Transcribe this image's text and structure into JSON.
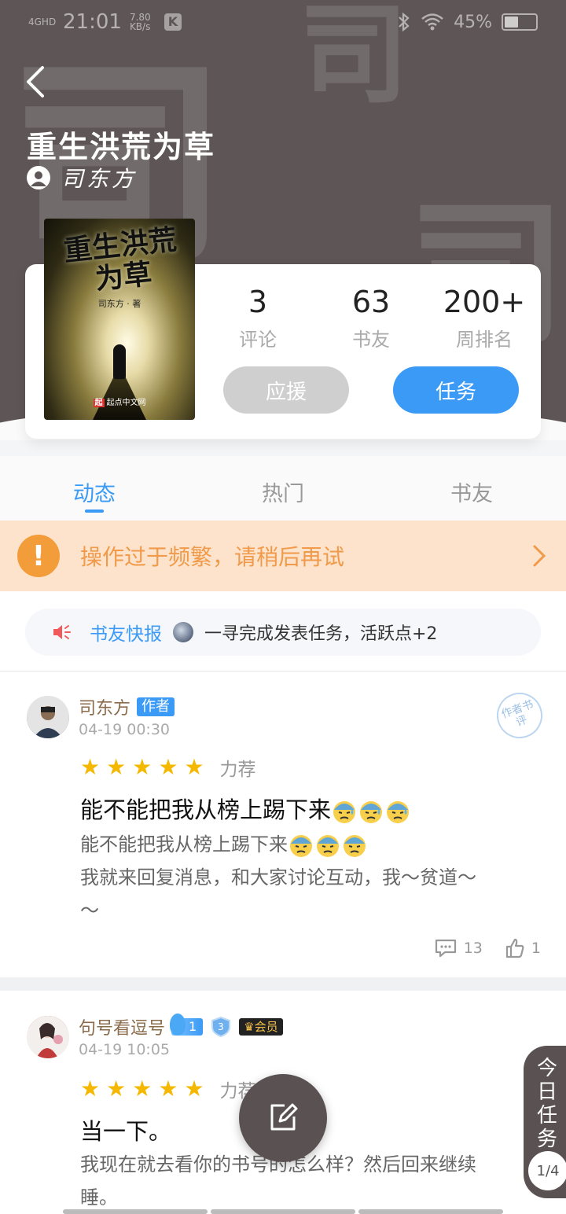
{
  "status_bar": {
    "network": "4GHD",
    "time": "21:01",
    "speed_value": "7.80",
    "speed_unit": "KB/s",
    "app_badge": "K",
    "battery": "45%",
    "battery_level": 0.45
  },
  "header": {
    "book_title": "重生洪荒为草",
    "author": "司东方"
  },
  "cover": {
    "title": "重生洪荒为草",
    "author_line": "司东方 · 著",
    "publisher_mark": "起",
    "publisher": "起点中文网"
  },
  "stats": [
    {
      "value": "3",
      "label": "评论"
    },
    {
      "value": "63",
      "label": "书友"
    },
    {
      "value": "200+",
      "label": "周排名"
    }
  ],
  "buttons": {
    "support": "应援",
    "task": "任务"
  },
  "tabs": [
    {
      "label": "动态",
      "active": true
    },
    {
      "label": "热门",
      "active": false
    },
    {
      "label": "书友",
      "active": false
    }
  ],
  "warning": {
    "icon": "!",
    "text": "操作过于频繁，请稍后再试"
  },
  "news": {
    "label": "书友快报",
    "text": "一寻完成发表任务，活跃点+2"
  },
  "posts": [
    {
      "username": "司东方",
      "badge": "作者",
      "time": "04-19 00:30",
      "stamp": "作者书评",
      "rating": 5,
      "recommend": "力荐",
      "title": "能不能把我从榜上踢下来",
      "body_line1": "能不能把我从榜上踢下来",
      "body_line2": "我就来回复消息，和大家讨论互动，我～贫道～",
      "body_line3": "～",
      "comments": "13",
      "likes": "1"
    },
    {
      "username": "句号看逗号",
      "fire_level": "1",
      "shield_level": "3",
      "member_badge": "会员",
      "time": "04-19 10:05",
      "rating": 5,
      "recommend": "力荐",
      "title": "当一下。",
      "body_line1": "我现在就去看你的书号的怎么样？然后回来继续",
      "body_line2": "睡。"
    }
  ],
  "floating": {
    "task_label": "今日任务",
    "task_progress": "1/4"
  },
  "colors": {
    "header_bg": "#5e5656",
    "accent_blue": "#3a9af5",
    "warning_bg": "#fde3cc",
    "warning_text": "#f09a4a",
    "star": "#f5b800"
  }
}
